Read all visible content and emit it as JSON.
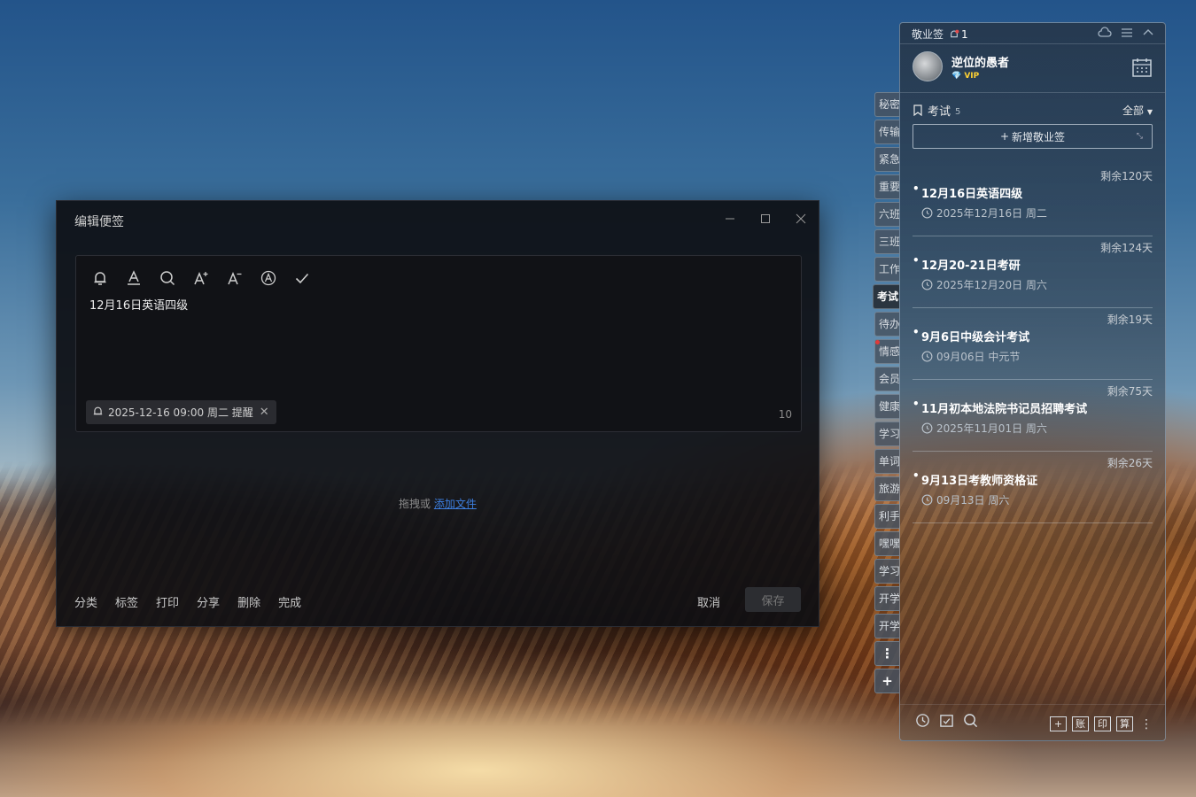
{
  "dialog": {
    "title": "编辑便签",
    "note_text": "12月16日英语四级",
    "reminder": "2025-12-16 09:00 周二 提醒",
    "char_count": "10",
    "drop_prefix": "拖拽或",
    "drop_link": "添加文件",
    "actions": [
      "分类",
      "标签",
      "打印",
      "分享",
      "删除",
      "完成"
    ],
    "cancel": "取消",
    "save": "保存",
    "toolbar_icons": [
      "bell-icon",
      "font-color-icon",
      "search-icon",
      "font-increase-icon",
      "font-decrease-icon",
      "font-style-icon",
      "check-icon"
    ]
  },
  "side_tabs": [
    {
      "label": "秘密"
    },
    {
      "label": "传输"
    },
    {
      "label": "紧急"
    },
    {
      "label": "重要"
    },
    {
      "label": "六班"
    },
    {
      "label": "三班"
    },
    {
      "label": "工作"
    },
    {
      "label": "考试",
      "active": true
    },
    {
      "label": "待办"
    },
    {
      "label": "情感",
      "dot": true
    },
    {
      "label": "会员"
    },
    {
      "label": "健康"
    },
    {
      "label": "学习"
    },
    {
      "label": "单词"
    },
    {
      "label": "旅游"
    },
    {
      "label": "利手"
    },
    {
      "label": "嘿嘿"
    },
    {
      "label": "学习"
    },
    {
      "label": "开学"
    },
    {
      "label": "开学"
    }
  ],
  "side_tab_more": "⋮",
  "side_tab_add": "+",
  "panel": {
    "app_name": "敬业签",
    "bell_count": "1",
    "user_name": "逆位的愚者",
    "vip": "VIP",
    "category": "考试",
    "category_count": "5",
    "filter": "全部",
    "new_button": "新增敬业签",
    "notes": [
      {
        "remain": "剩余120天",
        "title": "12月16日英语四级",
        "date": "2025年12月16日 周二"
      },
      {
        "remain": "剩余124天",
        "title": "12月20-21日考研",
        "date": "2025年12月20日 周六"
      },
      {
        "remain": "剩余19天",
        "title": "9月6日中级会计考试",
        "date": "09月06日 中元节"
      },
      {
        "remain": "剩余75天",
        "title": "11月初本地法院书记员招聘考试",
        "date": "2025年11月01日 周六"
      },
      {
        "remain": "剩余26天",
        "title": "9月13日考教师资格证",
        "date": "09月13日 周六"
      }
    ],
    "bottom_tools": [
      "账",
      "印",
      "算"
    ]
  }
}
